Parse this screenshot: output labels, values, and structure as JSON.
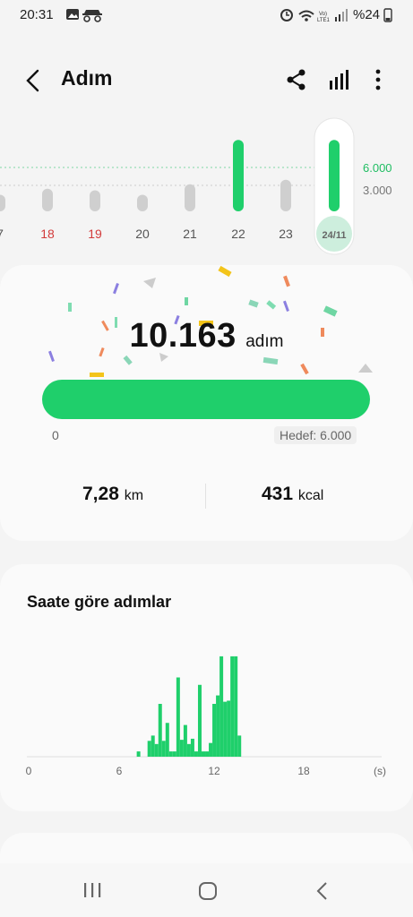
{
  "status": {
    "time": "20:31",
    "battery": "%24",
    "network": "Vo) LTE1"
  },
  "header": {
    "title": "Adım"
  },
  "week": {
    "days": [
      "7",
      "18",
      "19",
      "20",
      "21",
      "22",
      "23",
      "24/11"
    ],
    "day_colors": [
      "#555",
      "#d23b3b",
      "#d23b3b",
      "#555",
      "#555",
      "#555",
      "#555",
      "#666"
    ],
    "steps_levels": [
      0.22,
      0.3,
      0.28,
      0.22,
      0.36,
      0.95,
      0.42,
      0.95
    ],
    "goal_label": "6.000",
    "mid_label": "3.000"
  },
  "today": {
    "steps": "10.163",
    "steps_unit": "adım",
    "progress_min": "0",
    "goal_label": "Hedef: 6.000",
    "distance": "7,28",
    "distance_unit": "km",
    "calories": "431",
    "calories_unit": "kcal",
    "progress_fraction": 1.0
  },
  "hourly": {
    "title": "Saate göre adımlar",
    "x_ticks": [
      "0",
      "6",
      "12",
      "18",
      "(s)"
    ],
    "values": [
      0,
      0,
      0,
      0,
      0,
      0,
      0,
      0,
      0,
      0,
      0,
      0,
      0,
      0,
      0,
      0,
      0,
      0,
      0,
      0,
      0,
      0,
      0,
      0,
      0,
      0,
      0,
      0,
      0,
      0,
      0.05,
      0,
      0,
      0.15,
      0.2,
      0.12,
      0.5,
      0.15,
      0.32,
      0.05,
      0.05,
      0.75,
      0.16,
      0.3,
      0.12,
      0.17,
      0.05,
      0.68,
      0.05,
      0.05,
      0.13,
      0.5,
      0.58,
      0.95,
      0.52,
      0.53,
      0.95,
      0.95,
      0.2,
      0,
      0,
      0,
      0,
      0,
      0,
      0,
      0,
      0,
      0,
      0,
      0,
      0,
      0,
      0,
      0,
      0,
      0,
      0,
      0,
      0,
      0,
      0,
      0,
      0,
      0,
      0,
      0,
      0,
      0,
      0,
      0,
      0,
      0,
      0,
      0,
      0
    ]
  },
  "colors": {
    "accent": "#1fcf6b",
    "weekend": "#d23b3b",
    "bar_grey": "#cfcfcf"
  }
}
